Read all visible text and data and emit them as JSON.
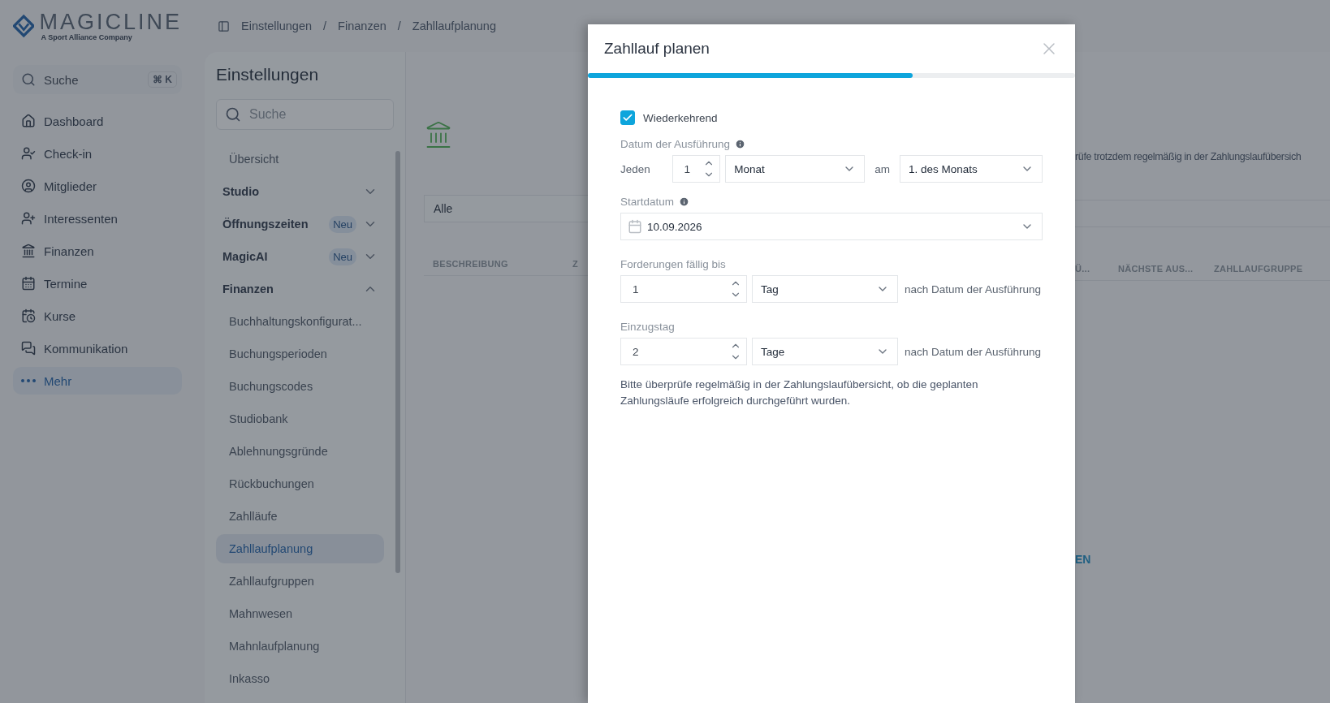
{
  "logo": {
    "name": "MAGICLINE",
    "tagline": "A Sport Alliance Company"
  },
  "breadcrumb": {
    "separator": "/",
    "items": [
      "Einstellungen",
      "Finanzen",
      "Zahllaufplanung"
    ]
  },
  "nav_search": {
    "placeholder": "Suche",
    "shortcut": "⌘ K"
  },
  "nav": [
    {
      "label": "Dashboard",
      "selected": false
    },
    {
      "label": "Check-in",
      "selected": false
    },
    {
      "label": "Mitglieder",
      "selected": false
    },
    {
      "label": "Interessenten",
      "selected": false
    },
    {
      "label": "Finanzen",
      "selected": false
    },
    {
      "label": "Termine",
      "selected": false
    },
    {
      "label": "Kurse",
      "selected": false
    },
    {
      "label": "Kommunikation",
      "selected": false
    },
    {
      "label": "Mehr",
      "selected": true
    }
  ],
  "settings": {
    "title": "Einstellungen",
    "search": {
      "placeholder": "Suche"
    },
    "items": [
      {
        "kind": "link",
        "label": "Übersicht",
        "selected": false
      },
      {
        "kind": "section",
        "label": "Studio",
        "expanded": false
      },
      {
        "kind": "section",
        "label": "Öffnungszeiten",
        "badge": "Neu",
        "expanded": false
      },
      {
        "kind": "section",
        "label": "MagicAI",
        "badge": "Neu",
        "expanded": false
      },
      {
        "kind": "section",
        "label": "Finanzen",
        "expanded": true,
        "children": [
          {
            "label": "Buchhaltungskonfigurat...",
            "selected": false
          },
          {
            "label": "Buchungsperioden",
            "selected": false
          },
          {
            "label": "Buchungscodes",
            "selected": false
          },
          {
            "label": "Studiobank",
            "selected": false
          },
          {
            "label": "Ablehnungsgründe",
            "selected": false
          },
          {
            "label": "Rückbuchungen",
            "selected": false
          },
          {
            "label": "Zahlläufe",
            "selected": false
          },
          {
            "label": "Zahllaufplanung",
            "selected": true
          },
          {
            "label": "Zahllaufgruppen",
            "selected": false
          },
          {
            "label": "Mahnwesen",
            "selected": false
          },
          {
            "label": "Mahnlaufplanung",
            "selected": false
          },
          {
            "label": "Inkasso",
            "selected": false
          }
        ]
      }
    ]
  },
  "main": {
    "notice": "rüfe trotzdem regelmäßig in der Zahlungslaufübersich",
    "filter": {
      "value": "Alle"
    },
    "columns_left": [
      "BESCHREIBUNG",
      "Z"
    ],
    "columns_right": [
      "Ü...",
      "NÄCHSTE AUS...",
      "ZAHLLAUFGRUPPE"
    ],
    "link": "EN"
  },
  "modal": {
    "title": "Zahllauf planen",
    "progress": {
      "level": 0.667
    },
    "recurring": {
      "label": "Wiederkehrend",
      "checked": true
    },
    "execution": {
      "label": "Datum der Ausführung",
      "every": "Jeden",
      "count": "1",
      "unit": "Monat",
      "on": "am",
      "day": "1. des Monats"
    },
    "start": {
      "label": "Startdatum",
      "value": "10.09.2026"
    },
    "due": {
      "label": "Forderungen fällig bis",
      "count": "1",
      "unit": "Tag",
      "suffix": "nach Datum der Ausführung"
    },
    "collection": {
      "label": "Einzugstag",
      "count": "2",
      "unit": "Tage",
      "suffix": "nach Datum der Ausführung"
    },
    "note": "Bitte überprüfe regelmäßig in der Zahlungslaufübersicht, ob die geplanten Zahlungsläufe erfolgreich durchgeführt wurden."
  }
}
